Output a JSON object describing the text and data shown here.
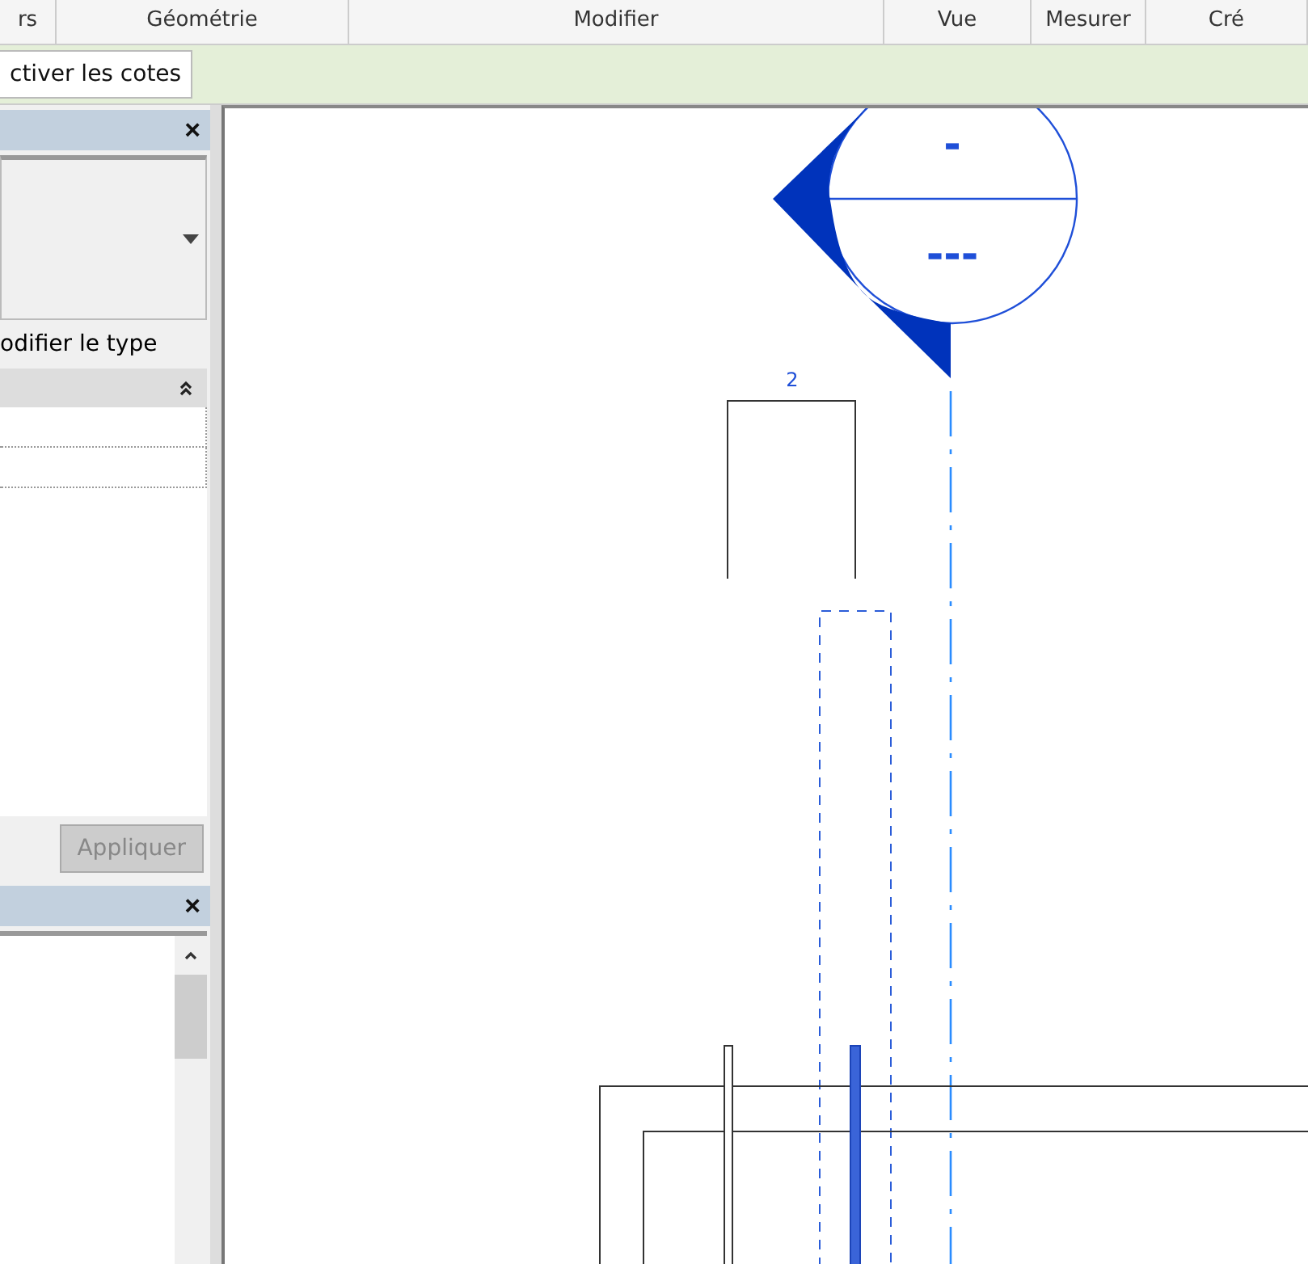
{
  "ribbon_tabs": [
    "rs",
    "Géométrie",
    "Modifier",
    "Vue",
    "Mesurer",
    "Cré"
  ],
  "toolbar": {
    "button": "ctiver les cotes"
  },
  "properties_panel": {
    "close": "×",
    "edit_type": "odifier le type",
    "apply": {
      "label": "Appliquer",
      "disabled": true
    }
  },
  "browser_panel": {
    "close": "×"
  },
  "drawing": {
    "section_top": "-",
    "section_bottom": "---",
    "dimension": "2"
  }
}
